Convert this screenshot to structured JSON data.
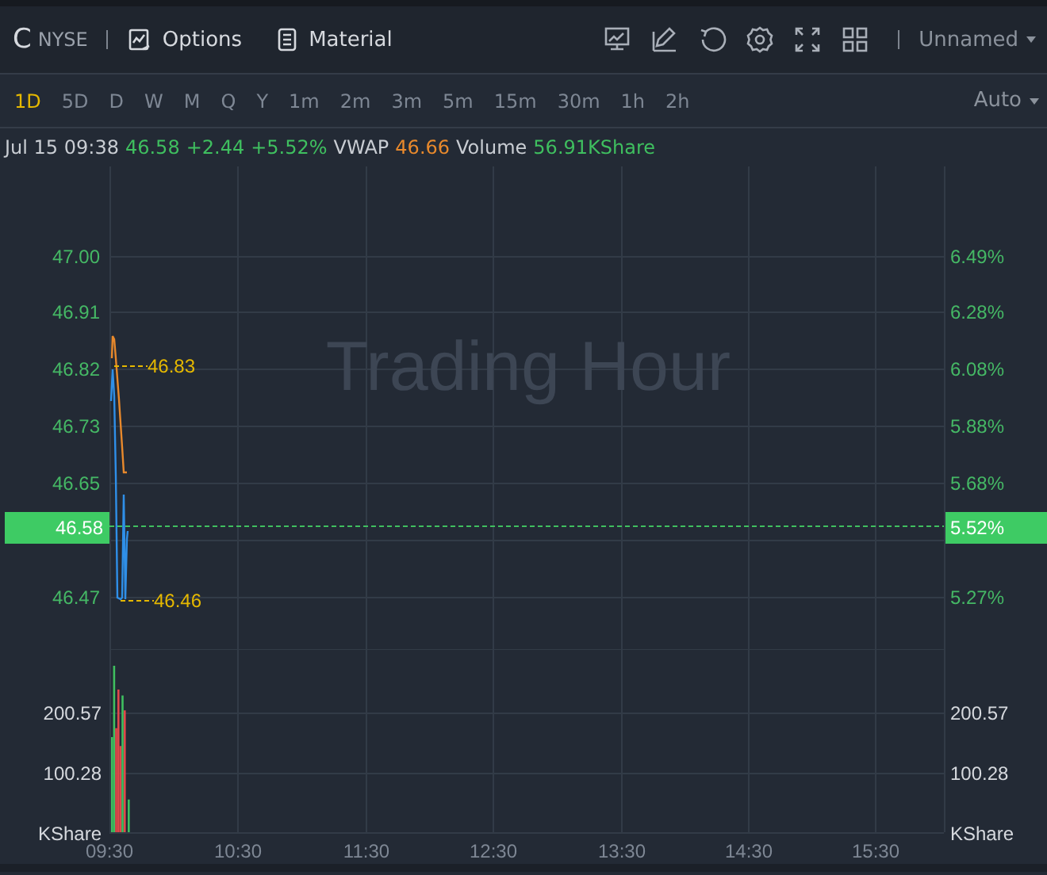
{
  "toolbar": {
    "symbol": "C",
    "exchange": "NYSE",
    "buttons": [
      {
        "kind": "options",
        "label": "Options"
      },
      {
        "kind": "material",
        "label": "Material"
      }
    ],
    "layout_menu": "Unnamed"
  },
  "periods": [
    {
      "label": "1D",
      "selected": true
    },
    {
      "label": "5D",
      "selected": false
    },
    {
      "label": "D",
      "selected": false
    },
    {
      "label": "W",
      "selected": false
    },
    {
      "label": "M",
      "selected": false
    },
    {
      "label": "Q",
      "selected": false
    },
    {
      "label": "Y",
      "selected": false
    },
    {
      "label": "1m",
      "selected": false
    },
    {
      "label": "2m",
      "selected": false
    },
    {
      "label": "3m",
      "selected": false
    },
    {
      "label": "5m",
      "selected": false
    },
    {
      "label": "15m",
      "selected": false
    },
    {
      "label": "30m",
      "selected": false
    },
    {
      "label": "1h",
      "selected": false
    },
    {
      "label": "2h",
      "selected": false
    }
  ],
  "scale_menu": "Auto",
  "quote": [
    {
      "text": "Jul 15 09:38",
      "color": "#c9cdd3"
    },
    {
      "text": "46.58",
      "color": "#3fbf5f"
    },
    {
      "text": "+2.44",
      "color": "#3fbf5f"
    },
    {
      "text": "+5.52%",
      "color": "#3fbf5f"
    },
    {
      "text": "VWAP",
      "color": "#c9cdd3"
    },
    {
      "text": "46.66",
      "color": "#e8892c"
    },
    {
      "text": "Volume",
      "color": "#c9cdd3"
    },
    {
      "text": "56.91KShare",
      "color": "#3fbf5f"
    }
  ],
  "price_panel": {
    "watermark": "Trading Hour",
    "left_ticks": [
      "47.00",
      "46.91",
      "46.82",
      "46.73",
      "46.65",
      "46.47"
    ],
    "right_ticks": [
      "6.49%",
      "6.28%",
      "6.08%",
      "5.88%",
      "5.68%",
      "5.27%"
    ],
    "high_marker": "46.83",
    "low_marker": "46.46",
    "current_price": "46.58",
    "current_change": "5.52%"
  },
  "volume_panel": {
    "left_ticks": [
      "200.57",
      "100.28",
      "KShare"
    ],
    "right_ticks": [
      "200.57",
      "100.28",
      "KShare"
    ],
    "time_axis": [
      "09:30",
      "10:30",
      "11:30",
      "12:30",
      "13:30",
      "14:30",
      "15:30"
    ]
  }
}
